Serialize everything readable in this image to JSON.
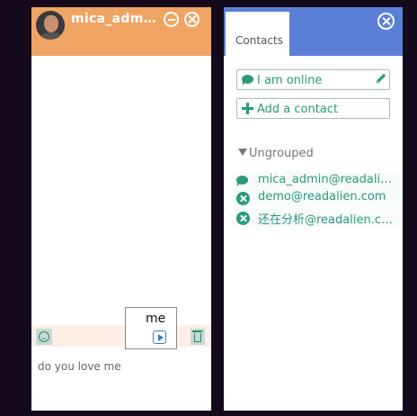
{
  "chat": {
    "title": "mica_admin@readalien.com",
    "tooltip_text": "me",
    "input_value": "do you love me"
  },
  "contacts": {
    "tab_label": "Contacts",
    "status_label": "I am online",
    "add_label": "Add a contact",
    "group_name": "Ungrouped",
    "items": [
      {
        "label": "mica_admin@readalien.com",
        "status": "online",
        "icon": "chat-bubble-icon"
      },
      {
        "label": "demo@readalien.com",
        "status": "offline",
        "icon": "offline-icon"
      },
      {
        "label": "还在分析@readalien.com",
        "status": "offline",
        "icon": "offline-icon"
      }
    ]
  },
  "colors": {
    "chat_header": "#f0a463",
    "contacts_header": "#5a7fd6",
    "accent": "#2a9a7a",
    "toolbar": "#fdeee8",
    "background": "#140a1c"
  }
}
